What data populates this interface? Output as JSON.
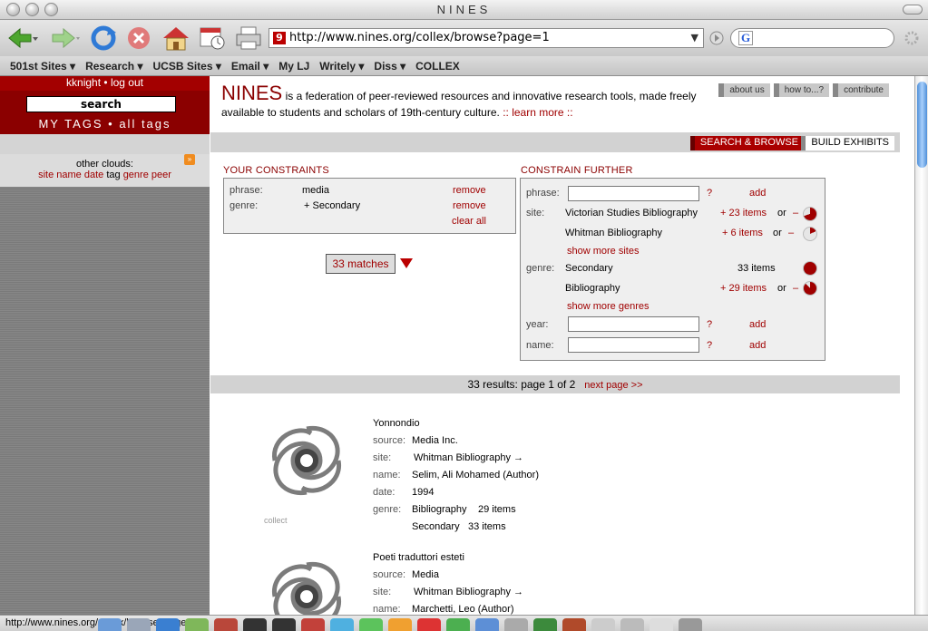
{
  "window": {
    "title": "NINES"
  },
  "toolbar": {
    "url": "http://www.nines.org/collex/browse?page=1",
    "url_icon": "9",
    "search_logo": "G",
    "icons": [
      "back-arrow-icon",
      "forward-arrow-icon",
      "reload-icon",
      "stop-icon",
      "home-icon",
      "history-icon",
      "print-icon"
    ]
  },
  "bookmarks": [
    "501st Sites ▾",
    "Research ▾",
    "UCSB Sites ▾",
    "Email ▾",
    "My LJ",
    "Writely ▾",
    "Diss ▾",
    "COLLEX"
  ],
  "sidebar": {
    "user": "kknight",
    "logout": "log out",
    "search_label": "search",
    "my_tags": "MY TAGS",
    "all_tags": "all tags",
    "other_clouds": "other clouds:",
    "clouds": [
      "site",
      "name",
      "date",
      "tag",
      "genre",
      "peer"
    ]
  },
  "header": {
    "logo": "NINES",
    "intro": "is a federation of peer-reviewed resources and innovative research tools, made freely available to students and scholars of 19th-century culture.",
    "learn_more": ":: learn more ::",
    "links": [
      "about us",
      "how to...?",
      "contribute"
    ],
    "tab_search": "SEARCH & BROWSE",
    "tab_build": "BUILD EXHIBITS"
  },
  "constraints": {
    "title": "YOUR CONSTRAINTS",
    "rows": [
      {
        "label": "phrase:",
        "value": "media",
        "action": "remove"
      },
      {
        "label": "genre:",
        "value": "+ Secondary",
        "action": "remove"
      }
    ],
    "clear_all": "clear all",
    "matches": "33 matches"
  },
  "further": {
    "title": "CONSTRAIN FURTHER",
    "phrase_label": "phrase:",
    "help": "?",
    "add": "add",
    "site_label": "site:",
    "sites": [
      {
        "name": "Victorian Studies Bibliography",
        "count": "+ 23 items",
        "or": "or",
        "minus": "–",
        "fraction": 0.7
      },
      {
        "name": "Whitman Bibliography",
        "count": "+ 6 items",
        "or": "or",
        "minus": "–",
        "fraction": 0.18
      }
    ],
    "show_more_sites": "show more sites",
    "genre_label": "genre:",
    "genres": [
      {
        "name": "Secondary",
        "count": "33 items",
        "or": "",
        "minus": "",
        "fraction": 1.0
      },
      {
        "name": "Bibliography",
        "count": "+ 29 items",
        "or": "or",
        "minus": "–",
        "fraction": 0.88
      }
    ],
    "show_more_genres": "show more genres",
    "year_label": "year:",
    "name_label": "name:"
  },
  "results": {
    "summary": "33 results: page 1 of 2",
    "next": "next page >>",
    "items": [
      {
        "title": "Yonnondio",
        "collect": "collect",
        "fields": [
          {
            "label": "source:",
            "value": "Media Inc."
          },
          {
            "label": "site:",
            "value": "Whitman Bibliography →",
            "link": true
          },
          {
            "label": "name:",
            "value": "Selim, Ali Mohamed (Author)"
          },
          {
            "label": "date:",
            "value": "1994"
          },
          {
            "label": "genre:",
            "value": "Bibliography",
            "extra": "29 items"
          },
          {
            "label": "",
            "value": "Secondary",
            "extra": "33 items"
          }
        ]
      },
      {
        "title": "Poeti traduttori esteti",
        "collect": "",
        "fields": [
          {
            "label": "source:",
            "value": "Media"
          },
          {
            "label": "site:",
            "value": "Whitman Bibliography →",
            "link": true
          },
          {
            "label": "name:",
            "value": "Marchetti, Leo (Author)"
          }
        ]
      }
    ]
  },
  "status": {
    "text": "http://www.nines.org/collex/browse?page="
  },
  "colors": {
    "accent": "#8b0000",
    "link": "#a00000"
  }
}
